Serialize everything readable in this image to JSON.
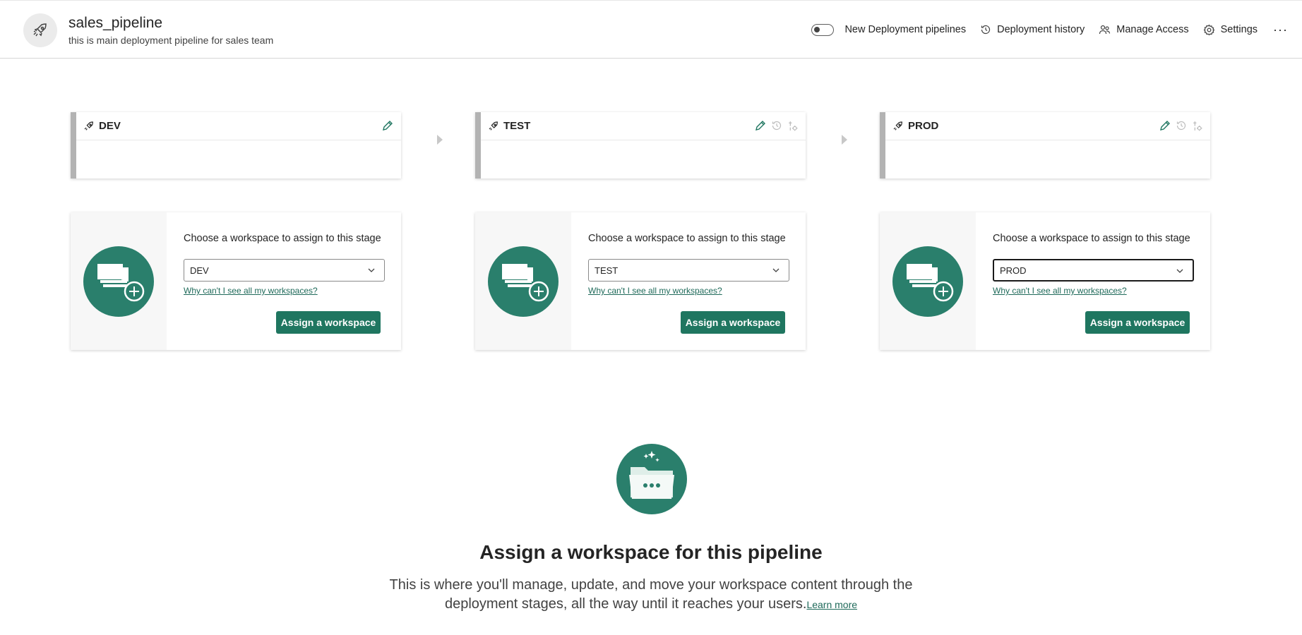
{
  "header": {
    "title": "sales_pipeline",
    "subtitle": "this is main deployment pipeline for sales team",
    "icon": "rocket-icon",
    "toggle_label": "New Deployment pipelines",
    "history_label": "Deployment history",
    "access_label": "Manage Access",
    "settings_label": "Settings",
    "more_label": "···"
  },
  "stages": [
    {
      "name": "DEV",
      "tools": [
        "pencil-icon"
      ]
    },
    {
      "name": "TEST",
      "tools": [
        "pencil-icon",
        "history-icon",
        "rules-icon"
      ]
    },
    {
      "name": "PROD",
      "tools": [
        "pencil-icon",
        "history-icon",
        "rules-icon"
      ]
    }
  ],
  "assign": [
    {
      "title": "Choose a workspace to assign to this stage",
      "selected": "DEV",
      "link": "Why can't I see all my workspaces?",
      "button": "Assign a workspace"
    },
    {
      "title": "Choose a workspace to assign to this stage",
      "selected": "TEST",
      "link": "Why can't I see all my workspaces?",
      "button": "Assign a workspace"
    },
    {
      "title": "Choose a workspace to assign to this stage",
      "selected": "PROD",
      "link": "Why can't I see all my workspaces?",
      "button": "Assign a workspace"
    }
  ],
  "empty_state": {
    "title": "Assign a workspace for this pipeline",
    "description": "This is where you'll manage, update, and move your workspace content through the deployment stages, all the way until it reaches your users.",
    "learn_more": "Learn more"
  },
  "colors": {
    "accent": "#1f7660",
    "circle": "#2a7f6c",
    "stage_bar": "#b3b3b3"
  }
}
